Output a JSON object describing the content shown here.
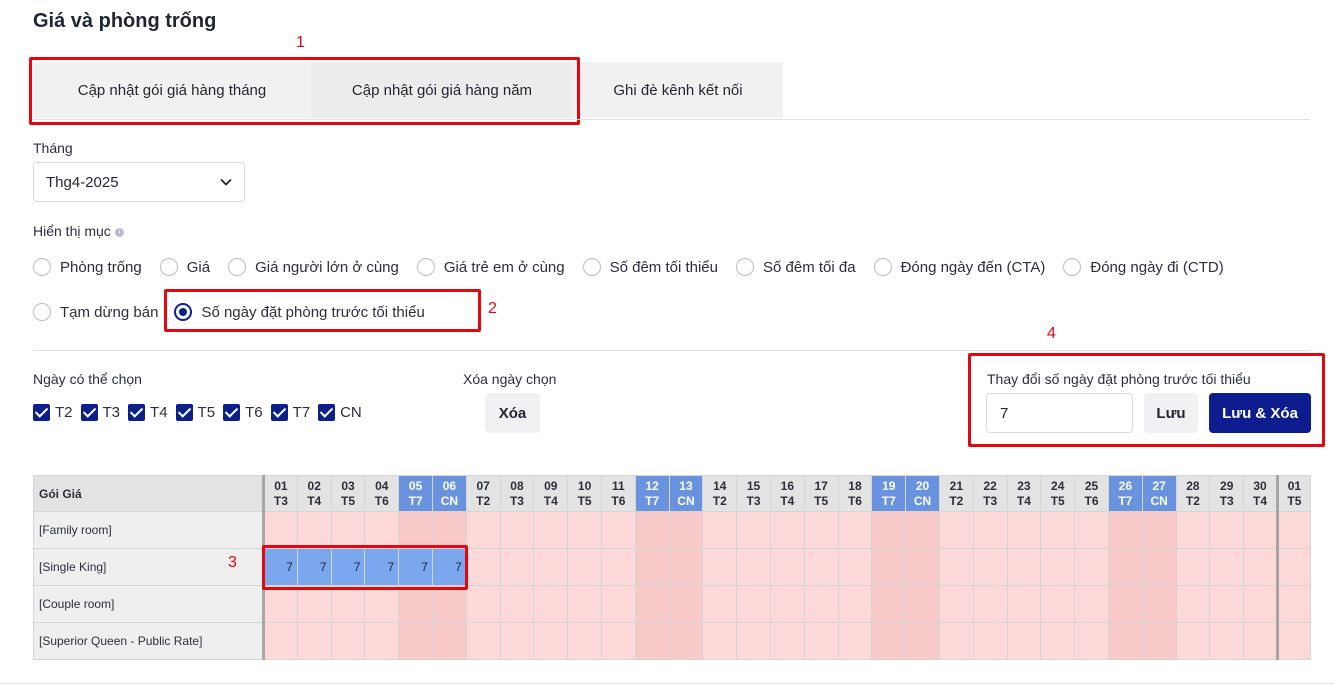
{
  "page_title": "Giá và phòng trống",
  "annotations": [
    "1",
    "2",
    "3",
    "4"
  ],
  "tabs": [
    {
      "label": "Cập nhật gói giá hàng tháng"
    },
    {
      "label": "Cập nhật gói giá hàng năm"
    },
    {
      "label": "Ghi đè kênh kết nối"
    }
  ],
  "month": {
    "label": "Tháng",
    "value": "Thg4-2025"
  },
  "display": {
    "label": "Hiển thị mục",
    "options": [
      "Phòng trống",
      "Giá",
      "Giá người lớn ở cùng",
      "Giá trẻ em ở cùng",
      "Số đêm tối thiểu",
      "Số đêm tối đa",
      "Đóng ngày đến (CTA)",
      "Đóng ngày đi (CTD)",
      "Tạm dừng bán",
      "Số ngày đặt phòng trước tối thiểu"
    ],
    "selected": "Số ngày đặt phòng trước tối thiểu"
  },
  "days_selectable": {
    "label": "Ngày có thể chọn",
    "days": [
      "T2",
      "T3",
      "T4",
      "T5",
      "T6",
      "T7",
      "CN"
    ]
  },
  "clear_selection": {
    "label": "Xóa ngày chọn",
    "button": "Xóa"
  },
  "change_panel": {
    "label": "Thay đổi số ngày đặt phòng trước tối thiểu",
    "value": "7",
    "save": "Lưu",
    "save_clear": "Lưu & Xóa"
  },
  "grid": {
    "header_label": "Gói Giá",
    "days": [
      {
        "d": "01",
        "w": "T3"
      },
      {
        "d": "02",
        "w": "T4"
      },
      {
        "d": "03",
        "w": "T5"
      },
      {
        "d": "04",
        "w": "T6"
      },
      {
        "d": "05",
        "w": "T7"
      },
      {
        "d": "06",
        "w": "CN"
      },
      {
        "d": "07",
        "w": "T2"
      },
      {
        "d": "08",
        "w": "T3"
      },
      {
        "d": "09",
        "w": "T4"
      },
      {
        "d": "10",
        "w": "T5"
      },
      {
        "d": "11",
        "w": "T6"
      },
      {
        "d": "12",
        "w": "T7"
      },
      {
        "d": "13",
        "w": "CN"
      },
      {
        "d": "14",
        "w": "T2"
      },
      {
        "d": "15",
        "w": "T3"
      },
      {
        "d": "16",
        "w": "T4"
      },
      {
        "d": "17",
        "w": "T5"
      },
      {
        "d": "18",
        "w": "T6"
      },
      {
        "d": "19",
        "w": "T7"
      },
      {
        "d": "20",
        "w": "CN"
      },
      {
        "d": "21",
        "w": "T2"
      },
      {
        "d": "22",
        "w": "T3"
      },
      {
        "d": "23",
        "w": "T4"
      },
      {
        "d": "24",
        "w": "T5"
      },
      {
        "d": "25",
        "w": "T6"
      },
      {
        "d": "26",
        "w": "T7"
      },
      {
        "d": "27",
        "w": "CN"
      },
      {
        "d": "28",
        "w": "T2"
      },
      {
        "d": "29",
        "w": "T3"
      },
      {
        "d": "30",
        "w": "T4"
      },
      {
        "d": "01",
        "w": "T5"
      }
    ],
    "rows": [
      {
        "name": "[Family room]",
        "values": []
      },
      {
        "name": "[Single King]",
        "values": [
          "7",
          "7",
          "7",
          "7",
          "7",
          "7"
        ]
      },
      {
        "name": "[Couple room]",
        "values": []
      },
      {
        "name": "[Superior Queen - Public Rate]",
        "values": []
      }
    ]
  }
}
